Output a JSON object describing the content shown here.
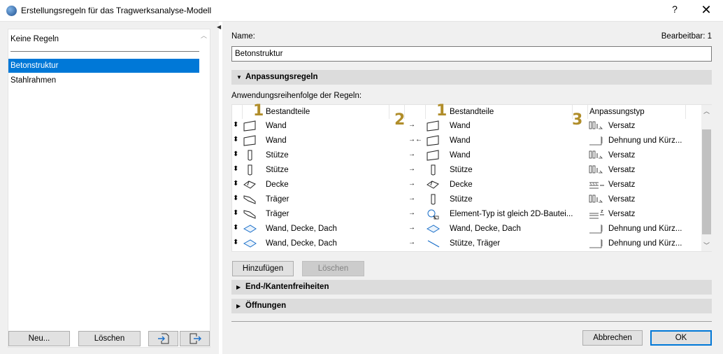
{
  "window": {
    "title": "Erstellungsregeln für das Tragwerksanalyse-Modell",
    "help_label": "?",
    "close_label": "✕"
  },
  "left": {
    "no_rules_label": "Keine Regeln",
    "items": [
      {
        "label": "Betonstruktur",
        "selected": true
      },
      {
        "label": "Stahlrahmen",
        "selected": false
      }
    ],
    "buttons": {
      "new": "Neu...",
      "delete": "Löschen"
    }
  },
  "right": {
    "name_label": "Name:",
    "editable_label": "Bearbeitbar: 1",
    "name_value": "Betonstruktur",
    "sections": {
      "adjustment_rules": "Anpassungsregeln",
      "end_edge": "End-/Kantenfreiheiten",
      "openings": "Öffnungen"
    },
    "order_label": "Anwendungsreihenfolge der Regeln:",
    "columns": {
      "components_1": "Bestandteile",
      "components_2": "Bestandteile",
      "adjust_type": "Anpassungstyp"
    },
    "badges": {
      "b1": "1",
      "b2": "2",
      "b3": "1",
      "b4": "3"
    },
    "rows": [
      {
        "c1": "Wand",
        "arrow": "→",
        "c2": "Wand",
        "c3": "Versatz",
        "icon1": "wall-icon",
        "icon2": "wall-icon",
        "icon3": "offset-icon"
      },
      {
        "c1": "Wand",
        "arrow": "→←",
        "c2": "Wand",
        "c3": "Dehnung und Kürz...",
        "icon1": "wall-icon",
        "icon2": "wall-icon",
        "icon3": "extend-trim-icon"
      },
      {
        "c1": "Stütze",
        "arrow": "→",
        "c2": "Wand",
        "c3": "Versatz",
        "icon1": "column-icon",
        "icon2": "wall-icon",
        "icon3": "offset-icon"
      },
      {
        "c1": "Stütze",
        "arrow": "→",
        "c2": "Stütze",
        "c3": "Versatz",
        "icon1": "column-icon",
        "icon2": "column-icon",
        "icon3": "offset-icon"
      },
      {
        "c1": "Decke",
        "arrow": "→",
        "c2": "Decke",
        "c3": "Versatz",
        "icon1": "slab-icon",
        "icon2": "slab-icon",
        "icon3": "slab-offset-icon"
      },
      {
        "c1": "Träger",
        "arrow": "→",
        "c2": "Stütze",
        "c3": "Versatz",
        "icon1": "beam-icon",
        "icon2": "column-icon",
        "icon3": "offset-icon"
      },
      {
        "c1": "Träger",
        "arrow": "→",
        "c2": "Element-Typ ist gleich 2D-Bautei...",
        "c3": "Versatz",
        "icon1": "beam-icon",
        "icon2": "element-type-icon",
        "icon3": "slab-offset-z-icon"
      },
      {
        "c1": "Wand, Decke, Dach",
        "arrow": "→",
        "c2": "Wand, Decke, Dach",
        "c3": "Dehnung und Kürz...",
        "icon1": "surface-icon",
        "icon2": "surface-icon",
        "icon3": "extend-trim-icon"
      },
      {
        "c1": "Wand, Decke, Dach",
        "arrow": "→",
        "c2": "Stütze, Träger",
        "c3": "Dehnung und Kürz...",
        "icon1": "surface-icon",
        "icon2": "line-member-icon",
        "icon3": "extend-trim-icon"
      }
    ],
    "table_buttons": {
      "add": "Hinzufügen",
      "delete": "Löschen"
    },
    "footer": {
      "cancel": "Abbrechen",
      "ok": "OK"
    }
  },
  "colors": {
    "selection": "#0078d7",
    "badge": "#b08d2a",
    "section_bg": "#dcdcdc"
  }
}
